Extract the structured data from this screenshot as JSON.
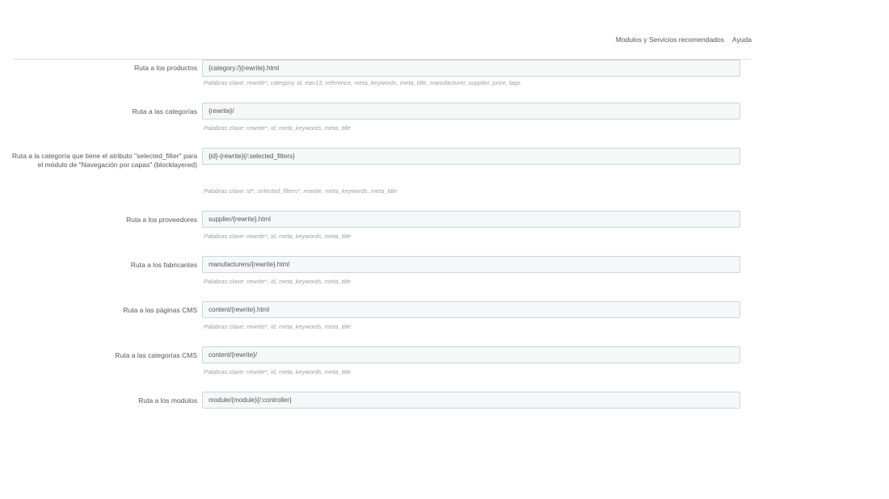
{
  "toolbar": {
    "recommended_link": "Modulos y Servicios recomendados",
    "help_link": "Ayuda"
  },
  "routes": [
    {
      "label": "Ruta a los productos",
      "value": "{category:/}{rewrite}.html",
      "help": "Palabras clave: rewrite*, category, id, ean13, reference, meta_keywords, meta_title, manufacturer, supplier, price, tags"
    },
    {
      "label": "Ruta a las categorías",
      "value": "{rewrite}/",
      "help": "Palabras clave: rewrite*, id, meta_keywords, meta_title"
    },
    {
      "label": "Ruta a la categoría que tiene el atributo \"selected_filter\" para el módulo de \"Navegación por capas\" (blocklayered)",
      "value": "{id}-{rewrite}{/:selected_filters}",
      "help": "Palabras clave: id*, selected_filters*, rewrite, meta_keywords, meta_title"
    },
    {
      "label": "Ruta a los proveedores",
      "value": "supplier/{rewrite}.html",
      "help": "Palabras clave: rewrite*, id, meta_keywords, meta_title"
    },
    {
      "label": "Ruta a los fabricantes",
      "value": "manufacturers/{rewrite}.html",
      "help": "Palabras clave: rewrite*, id, meta_keywords, meta_title"
    },
    {
      "label": "Ruta a las páginas CMS",
      "value": "content/{rewrite}.html",
      "help": "Palabras clave: rewrite*, id, meta_keywords, meta_title"
    },
    {
      "label": "Ruta a las categorías CMS",
      "value": "content/{rewrite}/",
      "help": "Palabras clave: rewrite*, id, meta_keywords, meta_title"
    },
    {
      "label": "Ruta a los modulos",
      "value": "module/{module}{/:controller}",
      "help": ""
    }
  ]
}
